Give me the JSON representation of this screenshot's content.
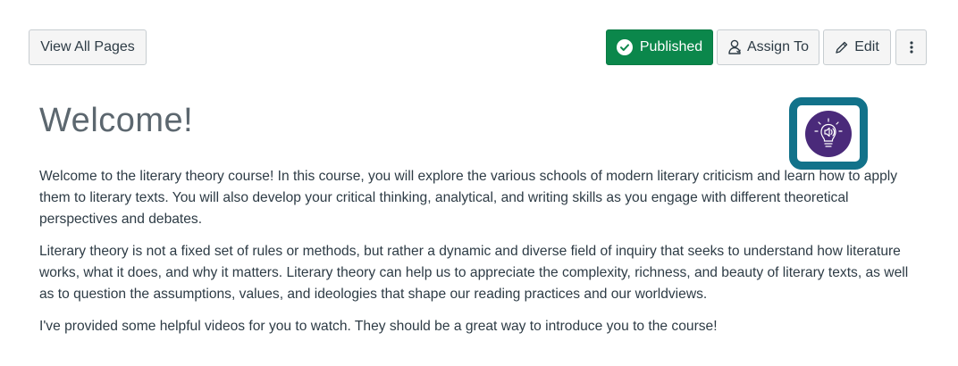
{
  "header": {
    "view_all_label": "View All Pages",
    "published_label": "Published",
    "assign_label": "Assign To",
    "edit_label": "Edit",
    "more_label": "⋮"
  },
  "page": {
    "title": "Welcome!",
    "paragraphs": [
      "Welcome to the literary theory course! In this course, you will explore the various schools of modern literary criticism and learn how to apply them to literary texts. You will also develop your critical thinking, analytical, and writing skills as you engage with different theoretical perspectives and debates.",
      "Literary theory is not a fixed set of rules or methods, but rather a dynamic and diverse field of inquiry that seeks to understand how literature works, what it does, and why it matters. Literary theory can help us to appreciate the complexity, richness, and beauty of literary texts, as well as to question the assumptions, values, and ideologies that shape our reading practices and our worldviews.",
      "I've provided some helpful videos for you to watch. They should be a great way to introduce you to the course!"
    ]
  },
  "icons": {
    "published": "check-circle-icon",
    "assign": "person-icon",
    "edit": "pencil-icon",
    "more": "kebab-icon",
    "tts": "lightbulb-speaker-icon"
  },
  "colors": {
    "published_bg": "#0b874b",
    "tts_frame": "#12728a",
    "tts_circle": "#4a2a7a",
    "text": "#2d3b45",
    "title": "#5c676f"
  }
}
